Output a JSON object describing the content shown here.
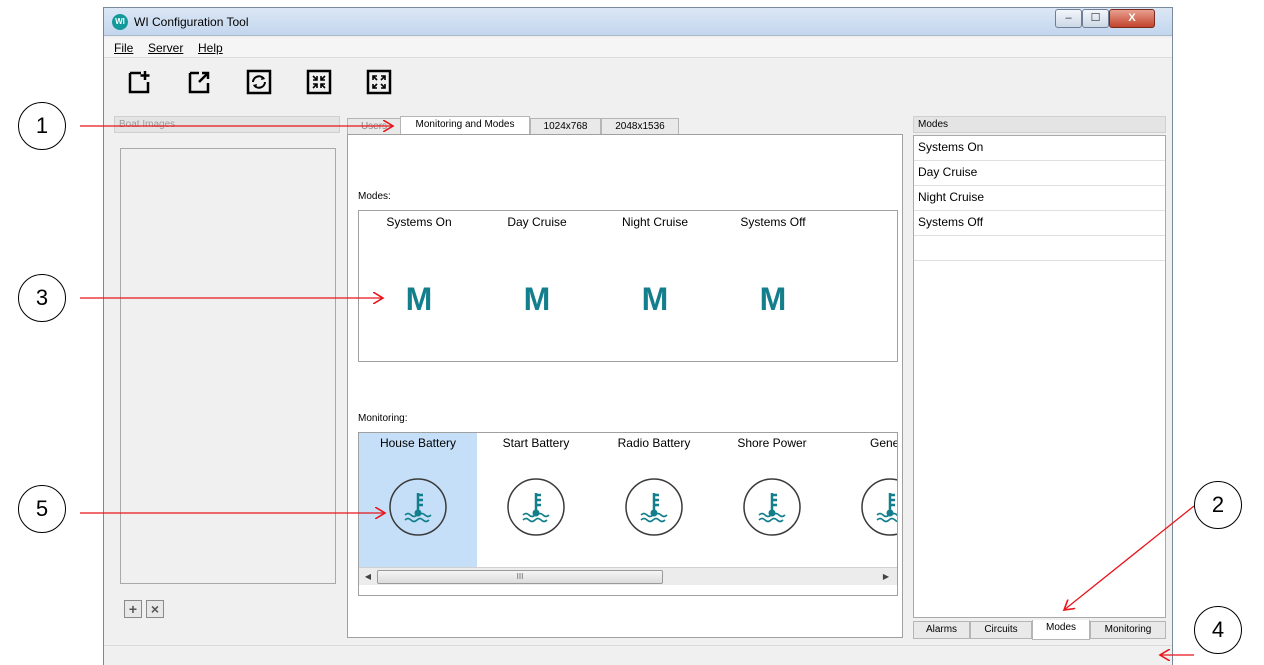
{
  "window": {
    "title": "WI Configuration Tool",
    "logo_glyph": "WI",
    "controls": {
      "minimize": "–",
      "maximize": "☐",
      "close": "X"
    }
  },
  "menu": {
    "file": "File",
    "server": "Server",
    "help": "Help"
  },
  "toolbar": {
    "buttons": [
      {
        "icon": "new-icon"
      },
      {
        "icon": "export-icon"
      },
      {
        "icon": "refresh-icon"
      },
      {
        "icon": "collapse-icon"
      },
      {
        "icon": "expand-icon"
      }
    ]
  },
  "left_panel": {
    "header": "Boat Images",
    "add_button": "+",
    "remove_button": "×"
  },
  "center": {
    "tabs": [
      "Users",
      "Monitoring and Modes",
      "1024x768",
      "2048x1536"
    ],
    "active_tab": "Monitoring and Modes",
    "modes_label": "Modes:",
    "modes": [
      {
        "name": "Systems On",
        "icon_text": "M"
      },
      {
        "name": "Day Cruise",
        "icon_text": "M"
      },
      {
        "name": "Night Cruise",
        "icon_text": "M"
      },
      {
        "name": "Systems Off",
        "icon_text": "M"
      }
    ],
    "monitoring_label": "Monitoring:",
    "monitoring": [
      {
        "name": "House Battery",
        "icon": "thermometer-icon",
        "selected": true
      },
      {
        "name": "Start Battery",
        "icon": "thermometer-icon"
      },
      {
        "name": "Radio Battery",
        "icon": "thermometer-icon"
      },
      {
        "name": "Shore Power",
        "icon": "thermometer-icon"
      },
      {
        "name": "Genera",
        "icon": "thermometer-icon"
      }
    ],
    "scrollbar": {
      "left_arrow": "◀",
      "right_arrow": "▶",
      "thumb_grip": "III"
    }
  },
  "right_panel": {
    "header": "Modes",
    "items": [
      "Systems On",
      "Day Cruise",
      "Night Cruise",
      "Systems Off",
      ""
    ],
    "bottom_tabs": [
      "Alarms",
      "Circuits",
      "Modes",
      "Monitoring"
    ],
    "active_bottom_tab": "Modes"
  },
  "annotations": [
    "1",
    "2",
    "3",
    "4",
    "5"
  ],
  "colors": {
    "accent": "#147f8c",
    "selection": "#c6dff8",
    "arrow": "#e8151b"
  }
}
